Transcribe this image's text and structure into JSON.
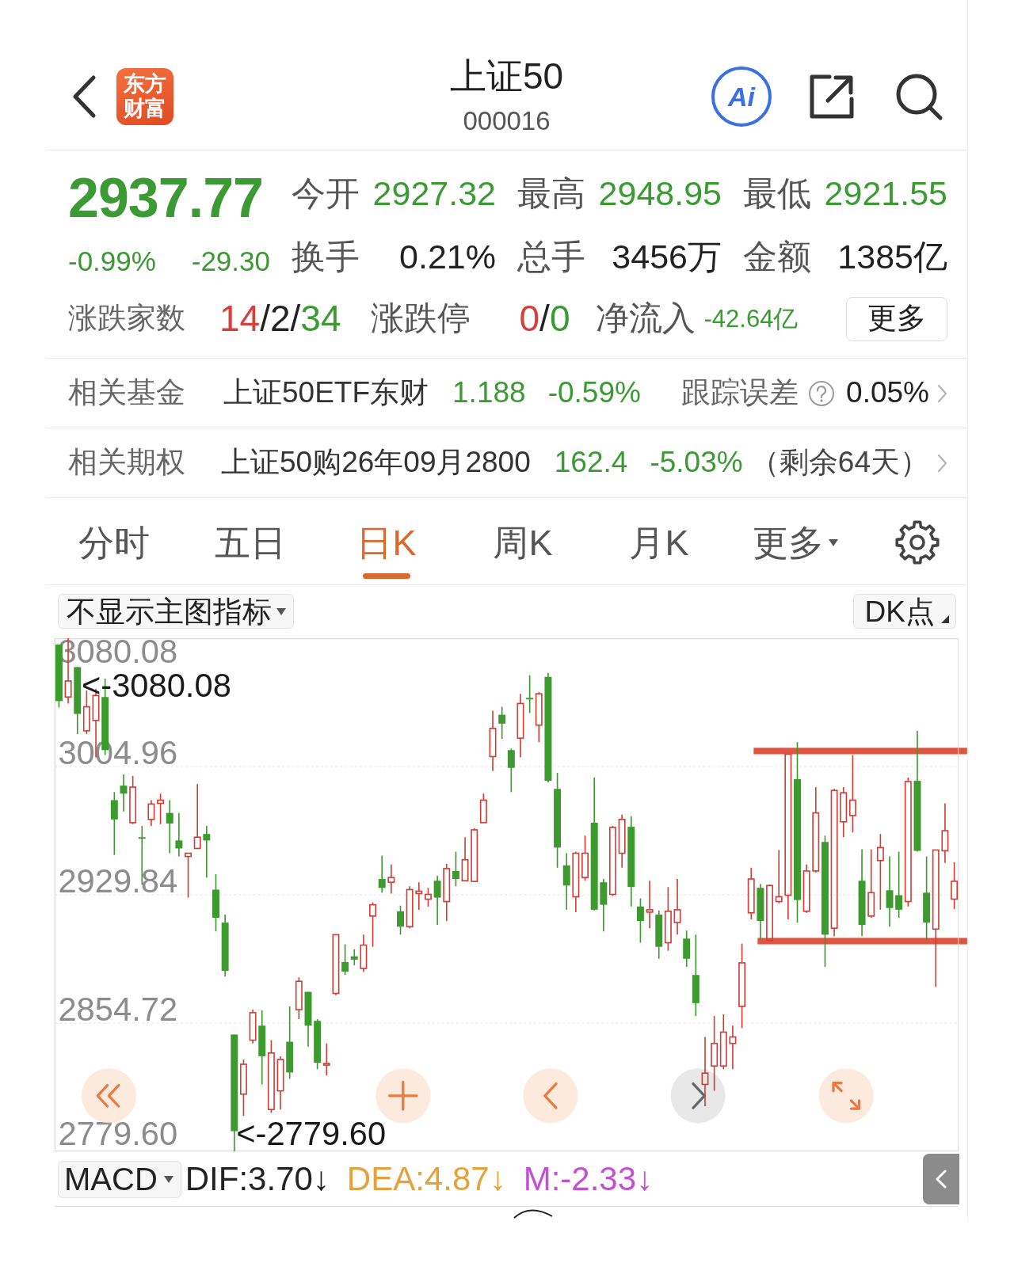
{
  "header": {
    "logo": "东方财富",
    "title": "上证50",
    "code": "000016",
    "ai_label": "Ai"
  },
  "quote": {
    "price": "2937.77",
    "change_percent": "-0.99%",
    "change": "-29.30",
    "color": "#3b9a33",
    "stats": [
      {
        "label": "今开",
        "value": "2927.32",
        "color": "#3b9a33"
      },
      {
        "label": "最高",
        "value": "2948.95",
        "color": "#3b9a33"
      },
      {
        "label": "最低",
        "value": "2921.55",
        "color": "#3b9a33"
      },
      {
        "label": "换手",
        "value": "0.21%",
        "color": "#222222"
      },
      {
        "label": "总手",
        "value": "3456万",
        "color": "#222222"
      },
      {
        "label": "金额",
        "value": "1385亿",
        "color": "#222222"
      }
    ],
    "breadth": {
      "label": "涨跌家数",
      "parts": [
        {
          "text": "14",
          "color": "#d6403a"
        },
        {
          "text": "/2/",
          "color": "#222222"
        },
        {
          "text": "34",
          "color": "#3b9a33"
        }
      ]
    },
    "limits": {
      "label": "涨跌停",
      "parts": [
        {
          "text": "0",
          "color": "#d6403a"
        },
        {
          "text": "/",
          "color": "#222222"
        },
        {
          "text": "0",
          "color": "#3b9a33"
        }
      ]
    },
    "net_inflow": {
      "label": "净流入",
      "value": "-42.64亿",
      "color": "#3b9a33"
    },
    "more_button": "更多"
  },
  "related": [
    {
      "kind": "fund",
      "label": "相关基金",
      "name": "上证50ETF东财",
      "price": "1.188",
      "change": "-0.59%",
      "color": "#3b9a33",
      "metric_label": "跟踪误差",
      "metric_value": "0.05%"
    },
    {
      "kind": "option",
      "label": "相关期权",
      "name": "上证50购26年09月2800",
      "price": "162.4",
      "change": "-5.03%",
      "color": "#3b9a33",
      "note": "（剩余64天）"
    }
  ],
  "tabs": [
    {
      "label": "分时",
      "kind": "period",
      "selected": false
    },
    {
      "label": "五日",
      "kind": "period",
      "selected": false
    },
    {
      "label": "日K",
      "kind": "period",
      "selected": true
    },
    {
      "label": "周K",
      "kind": "period",
      "selected": false
    },
    {
      "label": "月K",
      "kind": "period",
      "selected": false
    },
    {
      "label": "更多",
      "kind": "menu",
      "selected": false
    }
  ],
  "chart_toolbar": {
    "indicator": "不显示主图指标",
    "dk_label": "DK点"
  },
  "chart": {
    "high_marker": "<-3080.08",
    "low_marker": "<-2779.60",
    "chart_data": {
      "type": "candlestick",
      "grid": true,
      "ylim": [
        2779.6,
        3080.08
      ],
      "yticks": [
        {
          "value": 3080.08,
          "label": "3080.08"
        },
        {
          "value": 3004.96,
          "label": "3004.96"
        },
        {
          "value": 2929.84,
          "label": "2929.84"
        },
        {
          "value": 2854.72,
          "label": "2854.72"
        },
        {
          "value": 2779.6,
          "label": "2779.60"
        }
      ],
      "ohlc": [
        [
          3076.4,
          3076.4,
          3039.6,
          3043.3
        ],
        [
          3045.7,
          3080.08,
          3041.9,
          3055.1
        ],
        [
          3063.2,
          3063.2,
          3024.0,
          3035.8
        ],
        [
          3025.9,
          3049.5,
          3024.0,
          3040.0
        ],
        [
          3032.0,
          3050.4,
          3010.3,
          3046.6
        ],
        [
          3045.7,
          3056.5,
          3011.7,
          3014.6
        ],
        [
          2985.3,
          2990.0,
          2953.2,
          2974.0
        ],
        [
          2993.8,
          3000.4,
          2978.7,
          2989.1
        ],
        [
          2972.1,
          2999.5,
          2971.2,
          2992.9
        ],
        [
          2963.6,
          2970.2,
          2935.8,
          2962.7
        ],
        [
          2974.0,
          2985.3,
          2970.2,
          2983.0
        ],
        [
          2983.4,
          2989.1,
          2971.2,
          2985.3
        ],
        [
          2977.8,
          2985.3,
          2954.2,
          2971.6
        ],
        [
          2961.7,
          2977.8,
          2952.3,
          2957.0
        ],
        [
          2952.3,
          2954.2,
          2928.2,
          2954.2
        ],
        [
          2957.0,
          2994.7,
          2957.0,
          2963.6
        ],
        [
          2965.5,
          2970.2,
          2940.0,
          2961.7
        ],
        [
          2932.9,
          2941.9,
          2908.4,
          2916.4
        ],
        [
          2913.6,
          2918.3,
          2882.0,
          2885.3
        ],
        [
          2848.0,
          2848.0,
          2779.6,
          2791.4
        ],
        [
          2813.1,
          2833.4,
          2800.4,
          2830.6
        ],
        [
          2844.7,
          2862.6,
          2842.8,
          2860.8
        ],
        [
          2853.2,
          2862.2,
          2818.8,
          2835.3
        ],
        [
          2804.1,
          2844.7,
          2802.3,
          2837.2
        ],
        [
          2815.0,
          2835.3,
          2804.1,
          2833.4
        ],
        [
          2843.8,
          2864.5,
          2822.1,
          2825.8
        ],
        [
          2862.6,
          2881.5,
          2857.0,
          2879.2
        ],
        [
          2873.0,
          2873.0,
          2840.9,
          2853.2
        ],
        [
          2856.0,
          2857.0,
          2827.7,
          2831.5
        ],
        [
          2830.1,
          2842.8,
          2824.0,
          2831.0
        ],
        [
          2872.1,
          2906.5,
          2871.1,
          2906.5
        ],
        [
          2890.5,
          2900.9,
          2882.9,
          2884.8
        ],
        [
          2893.8,
          2898.0,
          2888.6,
          2891.9
        ],
        [
          2886.7,
          2906.5,
          2884.8,
          2900.4
        ],
        [
          2917.4,
          2925.4,
          2899.4,
          2924.0
        ],
        [
          2939.1,
          2952.8,
          2931.1,
          2933.9
        ],
        [
          2937.2,
          2947.6,
          2930.6,
          2940.0
        ],
        [
          2920.2,
          2923.5,
          2906.5,
          2911.2
        ],
        [
          2911.2,
          2934.8,
          2910.3,
          2932.9
        ],
        [
          2930.6,
          2937.2,
          2921.1,
          2932.0
        ],
        [
          2927.3,
          2933.9,
          2923.0,
          2930.1
        ],
        [
          2938.1,
          2941.0,
          2912.2,
          2928.2
        ],
        [
          2925.9,
          2948.0,
          2914.5,
          2945.2
        ],
        [
          2943.8,
          2955.1,
          2934.8,
          2939.1
        ],
        [
          2938.1,
          2963.6,
          2938.1,
          2950.4
        ],
        [
          2937.7,
          2968.8,
          2937.7,
          2967.9
        ],
        [
          2972.1,
          2989.1,
          2972.1,
          2985.3
        ],
        [
          3010.8,
          3037.7,
          3002.3,
          3027.3
        ],
        [
          3035.3,
          3040.0,
          3021.2,
          3030.1
        ],
        [
          3014.6,
          3015.5,
          2990.0,
          3004.2
        ],
        [
          3021.6,
          3047.6,
          3010.3,
          3041.9
        ],
        [
          3045.2,
          3058.4,
          3036.3,
          3044.3
        ],
        [
          3029.2,
          3048.5,
          3019.3,
          3047.6
        ],
        [
          3057.5,
          3059.8,
          2995.7,
          2996.6
        ],
        [
          2991.9,
          3001.3,
          2945.7,
          2957.5
        ],
        [
          2947.1,
          2954.2,
          2921.1,
          2935.3
        ],
        [
          2928.7,
          2955.1,
          2919.7,
          2954.2
        ],
        [
          2940.0,
          2964.5,
          2938.1,
          2954.2
        ],
        [
          2972.1,
          2998.5,
          2920.7,
          2921.1
        ],
        [
          2937.2,
          2939.1,
          2908.4,
          2924.0
        ],
        [
          2930.1,
          2970.2,
          2929.2,
          2969.3
        ],
        [
          2954.2,
          2976.8,
          2945.7,
          2974.0
        ],
        [
          2969.7,
          2975.9,
          2923.0,
          2934.4
        ],
        [
          2923.0,
          2927.8,
          2901.8,
          2914.5
        ],
        [
          2919.7,
          2938.1,
          2910.3,
          2921.1
        ],
        [
          2918.3,
          2920.7,
          2892.4,
          2899.4
        ],
        [
          2901.8,
          2934.4,
          2897.1,
          2920.2
        ],
        [
          2913.6,
          2939.1,
          2906.5,
          2921.1
        ],
        [
          2904.2,
          2908.9,
          2887.6,
          2892.4
        ],
        [
          2882.9,
          2906.5,
          2858.9,
          2866.4
        ],
        [
          2818.8,
          2846.6,
          2806.0,
          2825.4
        ],
        [
          2829.6,
          2858.9,
          2815.0,
          2842.8
        ],
        [
          2829.6,
          2859.8,
          2827.7,
          2849.4
        ],
        [
          2842.8,
          2853.2,
          2827.7,
          2846.6
        ],
        [
          2864.5,
          2901.3,
          2851.8,
          2890.0
        ],
        [
          2919.3,
          2945.7,
          2915.5,
          2939.1
        ],
        [
          2933.9,
          2936.2,
          2903.7,
          2914.5
        ],
        [
          2903.2,
          2935.8,
          2902.7,
          2935.3
        ],
        [
          2925.9,
          2956.1,
          2924.9,
          2928.7
        ],
        [
          2929.6,
          3012.7,
          2915.5,
          3012.2
        ],
        [
          2997.6,
          3019.3,
          2913.6,
          2926.8
        ],
        [
          2920.2,
          2947.6,
          2919.3,
          2943.8
        ],
        [
          2943.8,
          2992.9,
          2942.9,
          2977.8
        ],
        [
          2960.8,
          2964.5,
          2887.6,
          2906.5
        ],
        [
          2910.3,
          2991.9,
          2905.6,
          2991.0
        ],
        [
          2972.6,
          2992.9,
          2963.6,
          2989.6
        ],
        [
          2976.3,
          3011.7,
          2966.4,
          2985.3
        ],
        [
          2938.1,
          2956.5,
          2905.6,
          2912.2
        ],
        [
          2917.4,
          2956.5,
          2916.4,
          2931.1
        ],
        [
          2949.9,
          2965.5,
          2921.1,
          2957.5
        ],
        [
          2932.5,
          2952.3,
          2911.2,
          2922.1
        ],
        [
          2929.6,
          2955.1,
          2916.4,
          2921.1
        ],
        [
          2925.9,
          2998.5,
          2923.0,
          2996.2
        ],
        [
          2996.6,
          3025.9,
          2955.1,
          2955.6
        ],
        [
          2931.1,
          2952.3,
          2903.7,
          2913.6
        ],
        [
          2909.8,
          2956.1,
          2875.9,
          2956.1
        ],
        [
          2955.6,
          2983.4,
          2948.5,
          2967.4
        ],
        [
          2927.32,
          2948.95,
          2921.55,
          2937.77
        ]
      ]
    }
  },
  "macd": {
    "indicator": "MACD",
    "values": [
      {
        "text": "DIF:3.70↓",
        "color": "#222222"
      },
      {
        "text": "DEA:4.87↓",
        "color": "#e5a23b"
      },
      {
        "text": "M:-2.33↓",
        "color": "#c24fd4"
      }
    ]
  }
}
